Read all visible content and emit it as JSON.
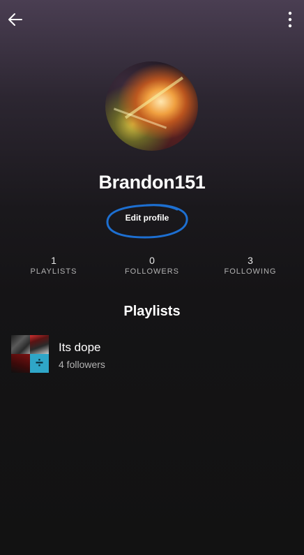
{
  "header": {
    "back_icon": "arrow-left-icon",
    "more_icon": "more-vertical-icon"
  },
  "profile": {
    "username": "Brandon151",
    "edit_label": "Edit profile",
    "edit_highlight_color": "#1d6fd1"
  },
  "stats": [
    {
      "value": "1",
      "label": "PLAYLISTS"
    },
    {
      "value": "0",
      "label": "FOLLOWERS"
    },
    {
      "value": "3",
      "label": "FOLLOWING"
    }
  ],
  "playlists_section": {
    "title": "Playlists",
    "items": [
      {
        "name": "Its dope",
        "subtitle": "4 followers"
      }
    ]
  },
  "colors": {
    "background": "#121212",
    "header_tint": "#4a3e52",
    "text_primary": "#ffffff",
    "text_secondary": "#b3b3b3"
  }
}
